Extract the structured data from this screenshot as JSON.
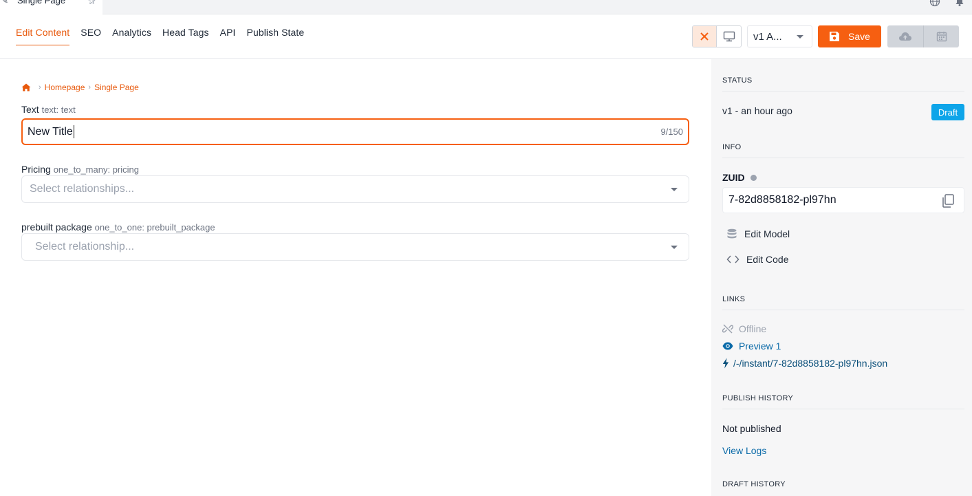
{
  "tabstrip": {
    "tab_label": "Single Page"
  },
  "nav": {
    "tabs": [
      {
        "label": "Edit Content",
        "active": true
      },
      {
        "label": "SEO",
        "active": false
      },
      {
        "label": "Analytics",
        "active": false
      },
      {
        "label": "Head Tags",
        "active": false
      },
      {
        "label": "API",
        "active": false
      },
      {
        "label": "Publish State",
        "active": false
      }
    ]
  },
  "toolbar": {
    "version_value": "v1  A...",
    "save_label": "Save",
    "accent": "#f65f11"
  },
  "breadcrumb": {
    "items": [
      "Homepage",
      "Single Page"
    ]
  },
  "fields": {
    "text": {
      "label": "Text",
      "meta": "text: text",
      "value": "New Title",
      "counter": "9/150"
    },
    "pricing": {
      "label": "Pricing",
      "meta": "one_to_many: pricing",
      "placeholder": "Select relationships..."
    },
    "prebuilt": {
      "label": "prebuilt package",
      "meta": "one_to_one: prebuilt_package",
      "placeholder": "Select relationship..."
    }
  },
  "sidebar": {
    "status_title": "STATUS",
    "status_line": "v1 - an hour ago",
    "status_badge": "Draft",
    "info_title": "INFO",
    "zuid_label": "ZUID",
    "zuid_value": "7-82d8858182-pl97hn",
    "edit_model": "Edit Model",
    "edit_code": "Edit Code",
    "links_title": "LINKS",
    "offline": "Offline",
    "preview": "Preview 1",
    "instant": "/-/instant/7-82d8858182-pl97hn.json",
    "publish_history_title": "PUBLISH HISTORY",
    "not_published": "Not published",
    "view_logs": "View Logs",
    "draft_history_title": "DRAFT HISTORY"
  }
}
